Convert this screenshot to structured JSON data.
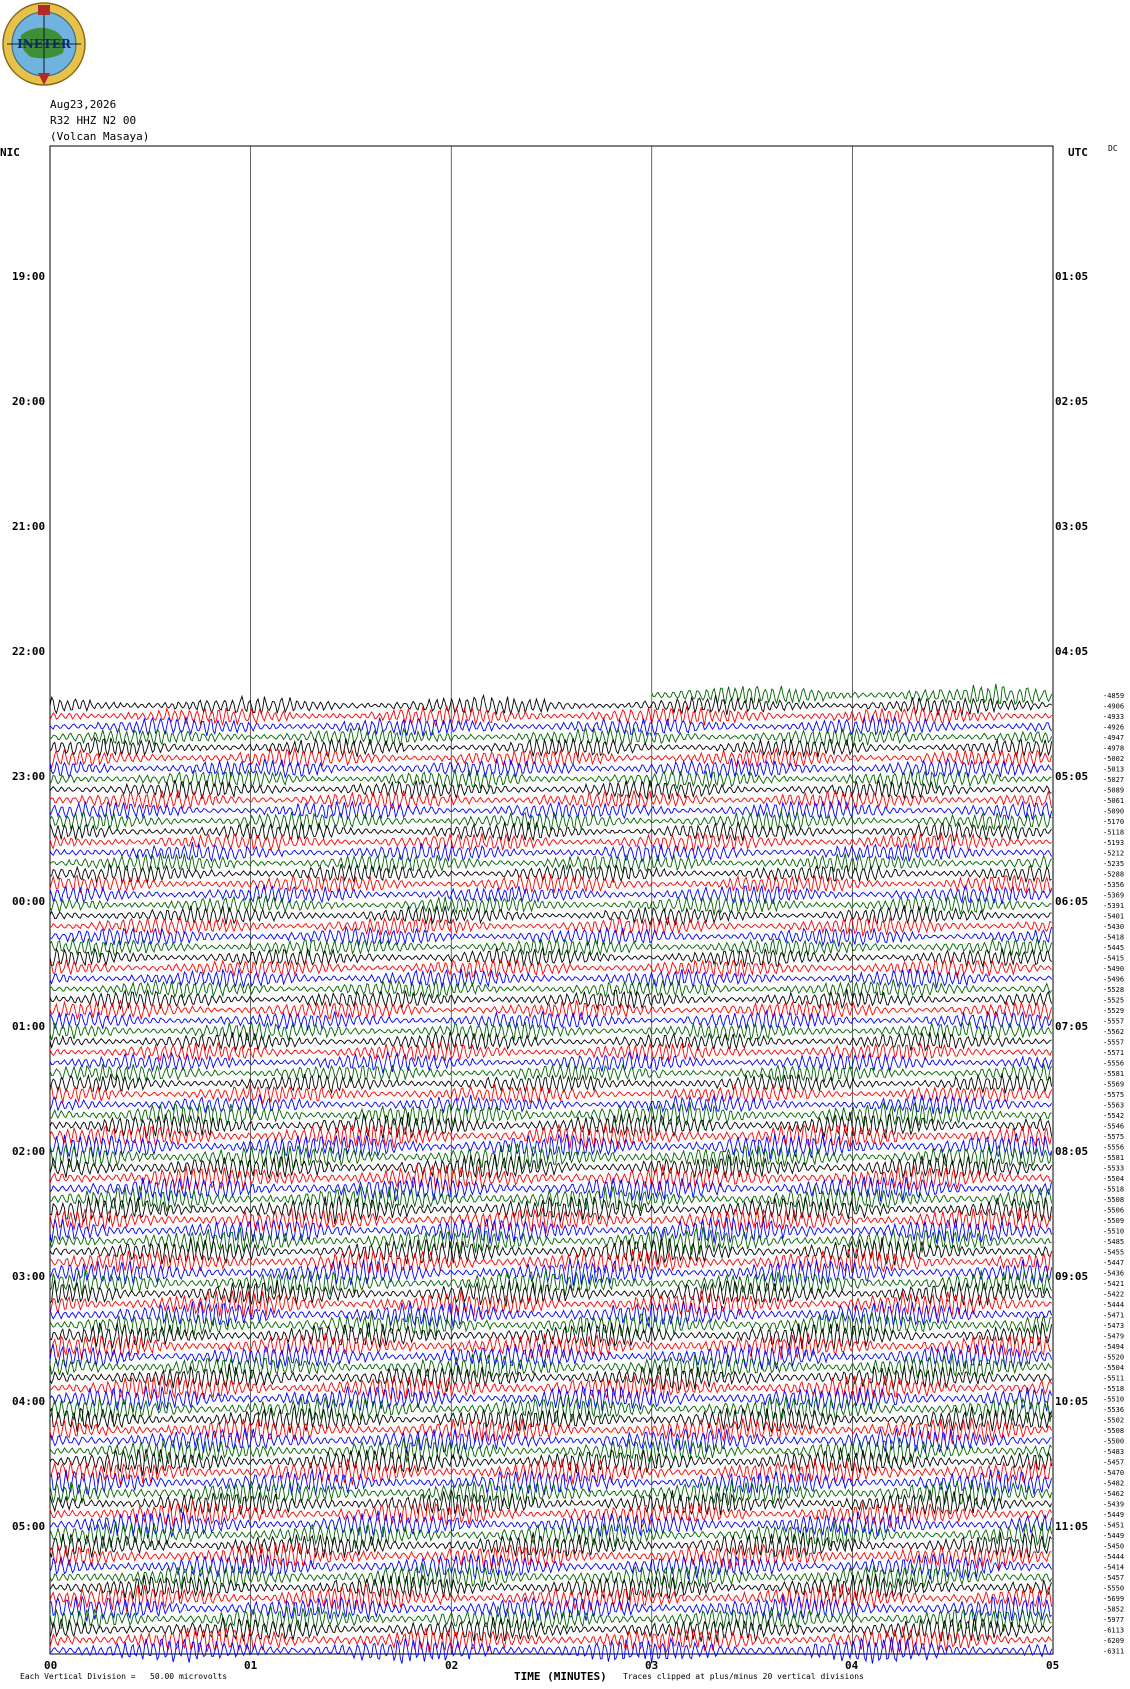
{
  "header": {
    "date": "Aug23,2026",
    "station": "R32 HHZ N2 00",
    "site": "(Volcan Masaya)"
  },
  "logo": {
    "text": "INETER",
    "colors": {
      "ring": "#c8a83a",
      "globe": "#5a9ec8",
      "land": "#2e7d32"
    }
  },
  "tz": {
    "left": "NIC",
    "right": "UTC",
    "dc": "DC"
  },
  "time_labels": {
    "left": [
      "19:00",
      "20:00",
      "21:00",
      "22:00",
      "23:00",
      "00:00",
      "01:00",
      "02:00",
      "03:00",
      "04:00",
      "05:00"
    ],
    "right": [
      "01:05",
      "02:05",
      "03:05",
      "04:05",
      "05:05",
      "06:05",
      "07:05",
      "08:05",
      "09:05",
      "10:05",
      "11:05"
    ]
  },
  "footer": {
    "xlabel": "TIME (MINUTES)",
    "division": "Each Vertical Division =   50.00 microvolts",
    "clipped": "Traces clipped at plus/minus 20 vertical divisions"
  },
  "chart_data": {
    "type": "line",
    "xlabel": "TIME (MINUTES)",
    "x_ticks": [
      "00",
      "01",
      "02",
      "03",
      "04",
      "05"
    ],
    "xlim": [
      0,
      5
    ],
    "trace_colors": [
      "#000000",
      "#ff0000",
      "#0000ff",
      "#006400"
    ],
    "first_trace_start_minute": 3,
    "trace_count": 92,
    "trace_offsets": [
      "-4859",
      "-4906",
      "-4933",
      "-4926",
      "-4947",
      "-4978",
      "-5002",
      "-5013",
      "-5027",
      "-5089",
      "-5061",
      "-5090",
      "-5170",
      "-5118",
      "-5193",
      "-5212",
      "-5235",
      "-5288",
      "-5356",
      "-5369",
      "-5391",
      "-5401",
      "-5430",
      "-5418",
      "-5445",
      "-5415",
      "-5490",
      "-5496",
      "-5528",
      "-5525",
      "-5529",
      "-5557",
      "-5562",
      "-5557",
      "-5571",
      "-5556",
      "-5581",
      "-5569",
      "-5575",
      "-5563",
      "-5542",
      "-5546",
      "-5575",
      "-5556",
      "-5581",
      "-5533",
      "-5504",
      "-5518",
      "-5508",
      "-5506",
      "-5509",
      "-5510",
      "-5485",
      "-5455",
      "-5447",
      "-5436",
      "-5421",
      "-5422",
      "-5444",
      "-5471",
      "-5473",
      "-5479",
      "-5494",
      "-5520",
      "-5504",
      "-5511",
      "-5518",
      "-5510",
      "-5536",
      "-5502",
      "-5508",
      "-5500",
      "-5483",
      "-5457",
      "-5470",
      "-5482",
      "-5462",
      "-5439",
      "-5449",
      "-5451",
      "-5449",
      "-5450",
      "-5444",
      "-5414",
      "-5457",
      "-5550",
      "-5699",
      "-5852",
      "-5977",
      "-6113",
      "-6209",
      "-6311"
    ],
    "amplitude_scale": "Each Vertical Division = 50.00 microvolts",
    "clipping": "plus/minus 20 vertical divisions"
  }
}
